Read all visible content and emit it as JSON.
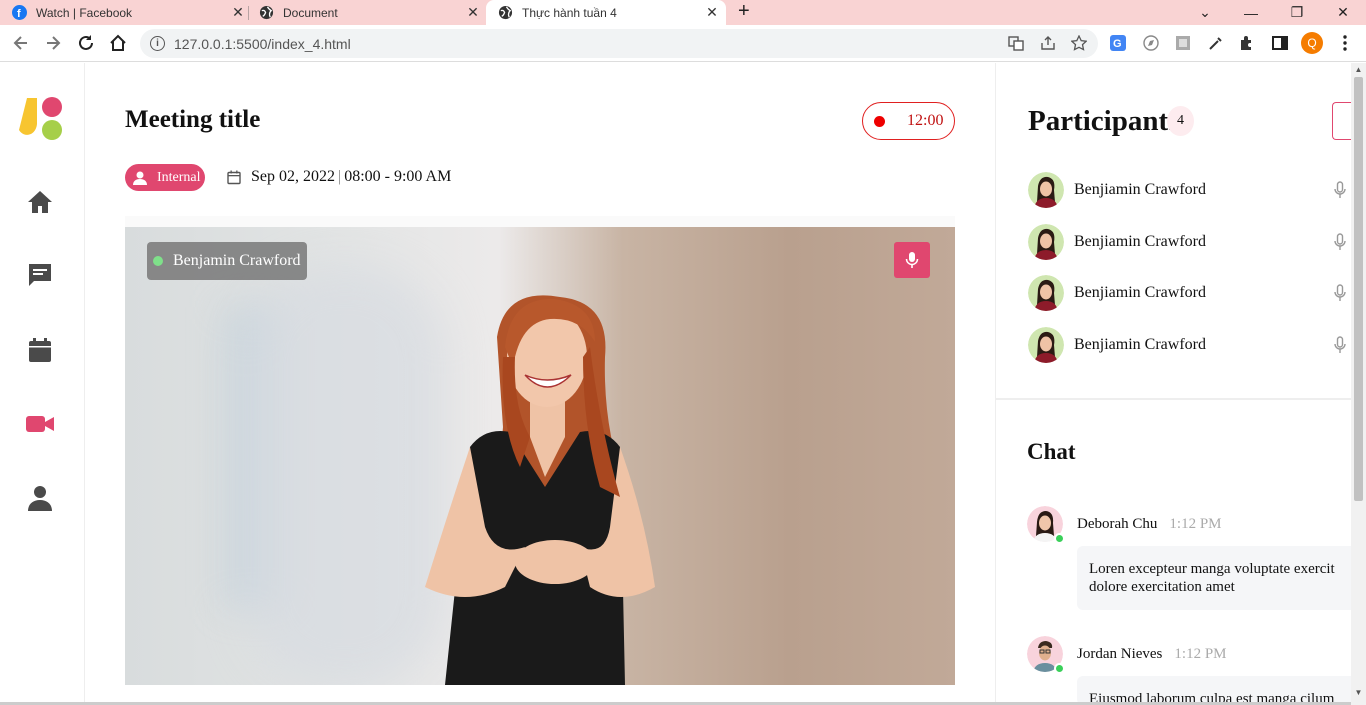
{
  "browser": {
    "tabs": [
      {
        "title": "Watch | Facebook",
        "icon": "facebook-icon"
      },
      {
        "title": "Document",
        "icon": "globe-icon"
      },
      {
        "title": "Thực hành tuần 4",
        "icon": "globe-icon",
        "active": true
      }
    ],
    "url": "127.0.0.1:5500/index_4.html",
    "profile_initial": "Q"
  },
  "sidebar": {
    "items": [
      {
        "icon": "home-icon"
      },
      {
        "icon": "chat-icon"
      },
      {
        "icon": "calendar-icon"
      },
      {
        "icon": "video-camera-icon",
        "active": true
      },
      {
        "icon": "user-icon"
      }
    ]
  },
  "meeting": {
    "title": "Meeting title",
    "recording_time": "12:00",
    "tag": "Internal",
    "date": "Sep 02, 2022",
    "separator": "|",
    "time_range": "08:00 - 9:00 AM",
    "speaker": "Benjamin Crawford"
  },
  "participants": {
    "title": "Participants",
    "count": "4",
    "list": [
      {
        "name": "Benjiamin Crawford"
      },
      {
        "name": "Benjiamin Crawford"
      },
      {
        "name": "Benjiamin Crawford"
      },
      {
        "name": "Benjiamin Crawford"
      }
    ]
  },
  "chat": {
    "title": "Chat",
    "messages": [
      {
        "author": "Deborah Chu",
        "time": "1:12 PM",
        "line1": "Loren excepteur manga voluptate exercit",
        "line2": "dolore exercitation amet"
      },
      {
        "author": "Jordan Nieves",
        "time": "1:12 PM",
        "line1": "Eiusmod laborum culpa est manga cilum"
      }
    ]
  },
  "colors": {
    "accent": "#e0476f",
    "recording": "#e00000",
    "online": "#3ad05a",
    "tab_strip": "#f9d3d3"
  }
}
